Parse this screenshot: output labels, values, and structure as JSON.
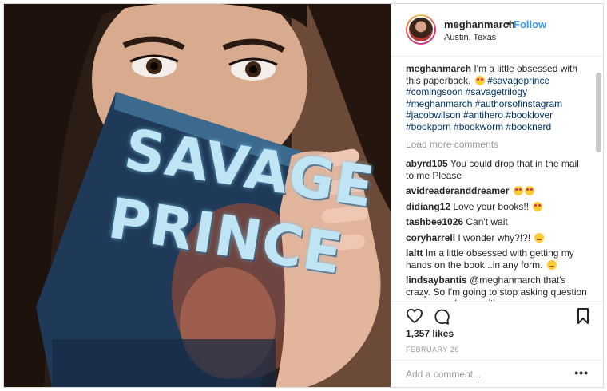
{
  "post": {
    "username": "meghanmarch",
    "follow_label": "Follow",
    "separator": "•",
    "location": "Austin, Texas",
    "book_title_line1": "SAVAGE",
    "book_title_line2": "PRINCE"
  },
  "caption": {
    "user": "meghanmarch",
    "text": "I'm a little obsessed with this paperback.",
    "hashtags_line1": "#savageprince",
    "hashtags_line2": "#comingsoon #savagetrilogy",
    "hashtags_line3": "#meghanmarch #authorsofinstagram",
    "hashtags_line4": "#jacobwilson #antihero #booklover",
    "hashtags_line5": "#bookporn #bookworm #booknerd"
  },
  "load_more": "Load more comments",
  "comments": [
    {
      "user": "abyrd105",
      "text": "You could drop that in the mail to me Please"
    },
    {
      "user": "avidreaderanddreamer",
      "text": ""
    },
    {
      "user": "didiang12",
      "text": "Love your books!!"
    },
    {
      "user": "tashbee1026",
      "text": "Can't wait"
    },
    {
      "user": "coryharrell",
      "text": "I wonder why?!?!"
    },
    {
      "user": "laltt",
      "text": "Im a little obsessed with getting my hands on the book...in any form."
    },
    {
      "user": "lindsaybantis",
      "text": "@meghanmarch that's crazy. So I'm going to stop asking question so you can keep writing me"
    }
  ],
  "stats": {
    "likes": "1,357 likes",
    "date": "FEBRUARY 26"
  },
  "add_comment": {
    "placeholder": "Add a comment...",
    "more": "•••"
  },
  "colors": {
    "accent": "#3897f0",
    "hashtag": "#003569",
    "muted": "#999999"
  }
}
